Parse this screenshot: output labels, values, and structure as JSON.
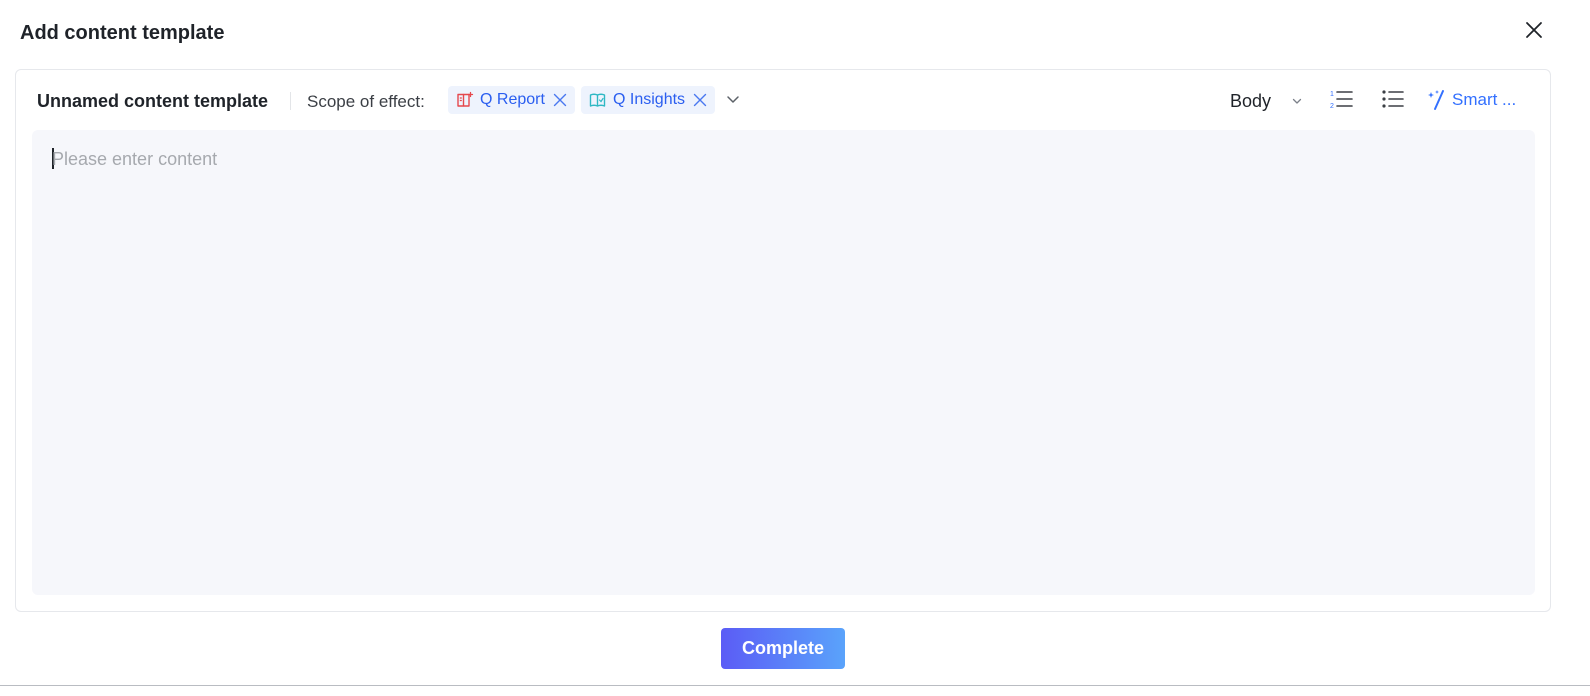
{
  "dialog": {
    "title": "Add content template",
    "close_icon": "close-icon"
  },
  "toolbar": {
    "template_name": "Unnamed content template",
    "scope_label": "Scope of effect:",
    "scope_tags": [
      {
        "label": "Q Report",
        "icon": "report-book-icon",
        "icon_color": "#e5484d"
      },
      {
        "label": "Q Insights",
        "icon": "insights-book-icon",
        "icon_color": "#2fb8c4"
      }
    ],
    "scope_dropdown_icon": "chevron-down-icon",
    "text_style": "Body",
    "ordered_list_icon": "ordered-list-icon",
    "bullet_list_icon": "bullet-list-icon",
    "smart_label": "Smart ..."
  },
  "editor": {
    "placeholder": "Please enter content",
    "value": ""
  },
  "footer": {
    "complete_label": "Complete"
  },
  "colors": {
    "accent": "#3370ff",
    "tag_text": "#2a5ef0",
    "tag_bg": "#eef3fd",
    "editor_bg": "#f6f7fb",
    "button_gradient_start": "#5b5cf6",
    "button_gradient_end": "#5aa3fb"
  }
}
